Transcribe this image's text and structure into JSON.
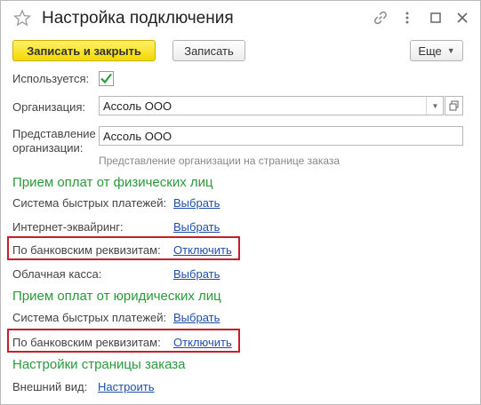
{
  "window": {
    "title": "Настройка подключения"
  },
  "toolbar": {
    "save_close_label": "Записать и закрыть",
    "save_label": "Записать",
    "more_label": "Еще"
  },
  "form": {
    "used_label": "Используется:",
    "used_checked": true,
    "org_label": "Организация:",
    "org_value": "Ассоль ООО",
    "org_repr_label_1": "Представление",
    "org_repr_label_2": "организации:",
    "org_repr_value": "Ассоль ООО",
    "org_repr_hint": "Представление организации на странице заказа"
  },
  "sections": {
    "individuals": {
      "title": "Прием оплат от физических лиц",
      "sbp_label": "Система быстрых платежей:",
      "sbp_link": "Выбрать",
      "acquiring_label": "Интернет-эквайринг:",
      "acquiring_link": "Выбрать",
      "bank_label": "По банковским реквизитам:",
      "bank_link": "Отключить",
      "cloud_label": "Облачная касса:",
      "cloud_link": "Выбрать"
    },
    "legal": {
      "title": "Прием оплат от юридических лиц",
      "sbp_label": "Система быстрых платежей:",
      "sbp_link": "Выбрать",
      "bank_label": "По банковским реквизитам:",
      "bank_link": "Отключить"
    },
    "order_page": {
      "title": "Настройки страницы заказа",
      "appearance_label": "Внешний вид:",
      "appearance_link": "Настроить"
    }
  },
  "colors": {
    "section_title": "#2a9a3a",
    "link": "#1f4fa8",
    "highlight_box": "#c8202a",
    "primary_button": "#f5d800",
    "checkmark": "#2a9a3a"
  },
  "icons": [
    "star-icon",
    "link-icon",
    "more-vertical-icon",
    "maximize-icon",
    "close-icon",
    "checkmark-icon",
    "dropdown-arrow-icon",
    "open-window-icon"
  ]
}
